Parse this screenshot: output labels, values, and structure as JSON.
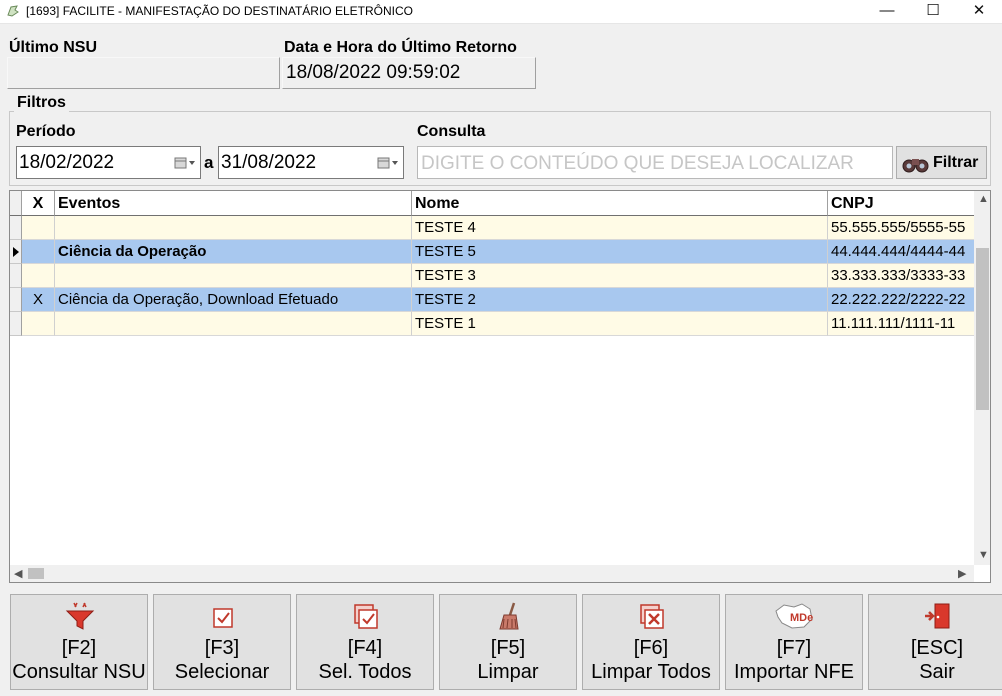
{
  "window": {
    "title": "[1693] FACILITE - MANIFESTAÇÃO DO DESTINATÁRIO ELETRÔNICO",
    "minimize": "—",
    "maximize": "☐",
    "close": "✕"
  },
  "header": {
    "ultimo_nsu_label": "Último NSU",
    "ultimo_nsu_value": "",
    "data_hora_label": "Data e Hora do Último Retorno",
    "data_hora_value": "18/08/2022 09:59:02"
  },
  "filters": {
    "group_title": "Filtros",
    "periodo_label": "Período",
    "date_from": "18/02/2022",
    "separator": "a",
    "date_to": "31/08/2022",
    "consulta_label": "Consulta",
    "search_placeholder": "DIGITE O CONTEÚDO QUE DESEJA LOCALIZAR",
    "filter_button": "Filtrar"
  },
  "grid": {
    "columns": [
      "X",
      "Eventos",
      "Nome",
      "CNPJ"
    ],
    "rows": [
      {
        "x": "",
        "eventos": "",
        "nome": "TESTE 4",
        "cnpj": "55.555.555/5555-55"
      },
      {
        "x": "",
        "eventos": "Ciência da Operação",
        "nome": "TESTE 5",
        "cnpj": "44.444.444/4444-44"
      },
      {
        "x": "",
        "eventos": "",
        "nome": "TESTE 3",
        "cnpj": "33.333.333/3333-33"
      },
      {
        "x": "X",
        "eventos": "Ciência da Operação, Download Efetuado",
        "nome": "TESTE 2",
        "cnpj": "22.222.222/2222-22"
      },
      {
        "x": "",
        "eventos": "",
        "nome": "TESTE 1",
        "cnpj": "11.111.111/1111-11"
      }
    ]
  },
  "buttons": [
    {
      "key": "[F2]",
      "label": "Consultar NSU",
      "icon": "funnel-icon"
    },
    {
      "key": "[F3]",
      "label": "Selecionar",
      "icon": "checkbox-icon"
    },
    {
      "key": "[F4]",
      "label": "Sel. Todos",
      "icon": "checkbox-multiple-icon"
    },
    {
      "key": "[F5]",
      "label": "Limpar",
      "icon": "broom-icon"
    },
    {
      "key": "[F6]",
      "label": "Limpar Todos",
      "icon": "clear-all-icon"
    },
    {
      "key": "[F7]",
      "label": "Importar NFE",
      "icon": "mde-map-icon",
      "icon_text": "MDe"
    },
    {
      "key": "[ESC]",
      "label": "Sair",
      "icon": "exit-door-icon"
    }
  ]
}
